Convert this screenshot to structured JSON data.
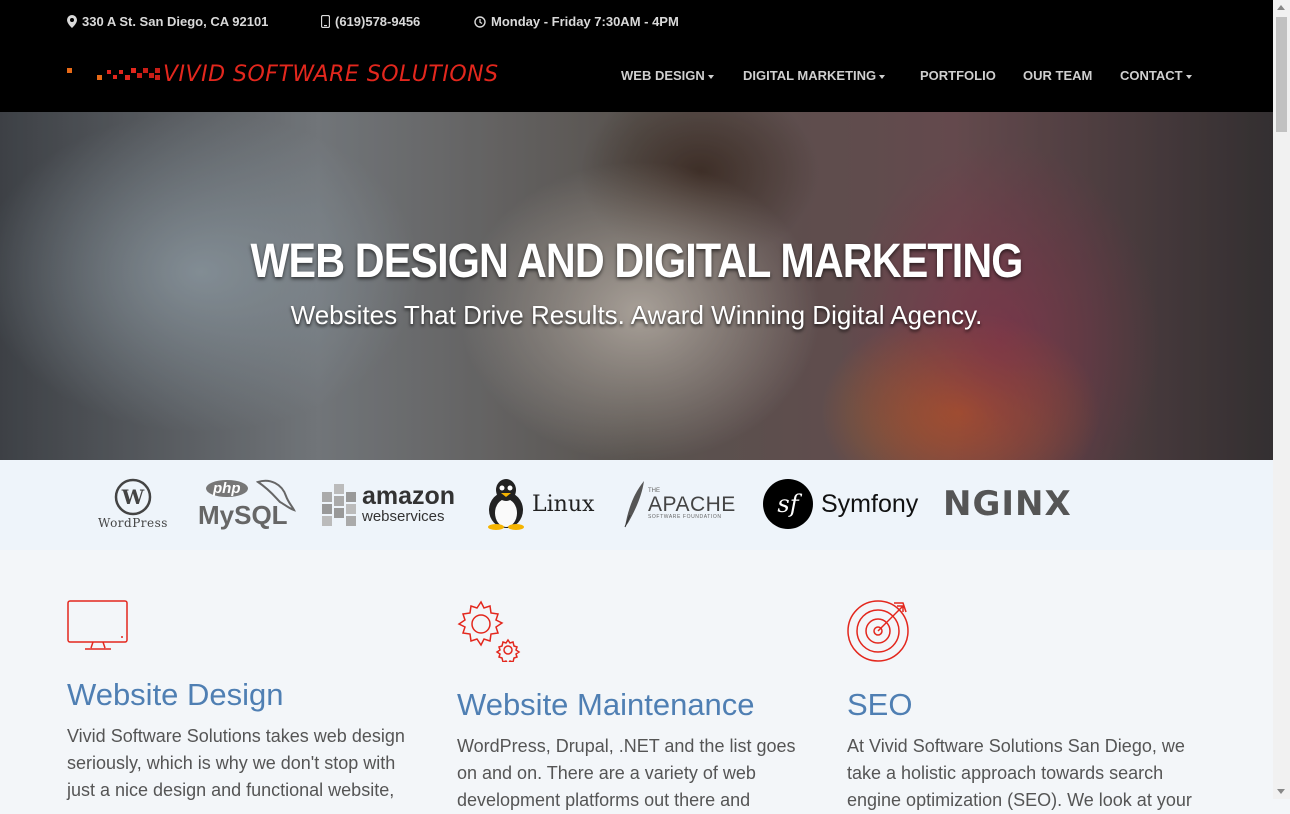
{
  "header": {
    "address": "330 A St. San Diego, CA 92101",
    "phone": "(619)578-9456",
    "hours": "Monday - Friday 7:30AM - 4PM",
    "logo_text": "VIVID SOFTWARE SOLUTIONS"
  },
  "nav": {
    "items": [
      {
        "label": "WEB DESIGN",
        "dropdown": true
      },
      {
        "label": "DIGITAL MARKETING",
        "dropdown": true
      },
      {
        "label": "PORTFOLIO",
        "dropdown": false
      },
      {
        "label": "OUR TEAM",
        "dropdown": false
      },
      {
        "label": "CONTACT",
        "dropdown": true
      }
    ]
  },
  "hero": {
    "title": "WEB DESIGN AND DIGITAL MARKETING",
    "subtitle": "Websites That Drive Results. Award Winning Digital Agency."
  },
  "tech_logos": {
    "wordpress": "WordPress",
    "mysql_top": "php",
    "mysql": "MySQL",
    "amazon": "amazon",
    "amazon_sub": "webservices",
    "linux": "Linux",
    "apache_the": "THE",
    "apache": "APACHE",
    "apache_sub": "SOFTWARE FOUNDATION",
    "symfony": "Symfony",
    "nginx": "NGINX"
  },
  "services": [
    {
      "icon": "monitor-icon",
      "title": "Website Design",
      "text": "Vivid Software Solutions takes web design seriously, which is why we don't stop with just a nice design and functional website,"
    },
    {
      "icon": "gears-icon",
      "title": "Website Maintenance",
      "text": "WordPress, Drupal, .NET and the list goes on and on. There are a variety of web development platforms out there and"
    },
    {
      "icon": "target-icon",
      "title": "SEO",
      "text": "At Vivid Software Solutions San Diego, we take a holistic approach towards search engine optimization (SEO). We look at your"
    }
  ],
  "colors": {
    "brand_red": "#e3271d",
    "heading_blue": "#4f7fb3",
    "topbar": "#000000"
  }
}
